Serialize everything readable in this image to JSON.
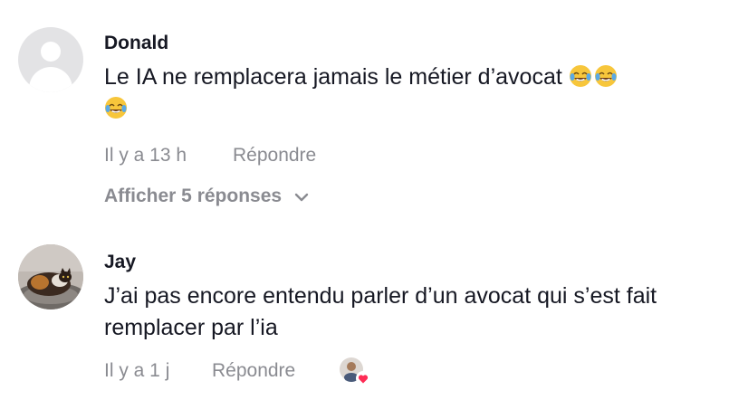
{
  "comments": [
    {
      "username": "Donald",
      "text": "Le IA ne remplacera jamais le métier d’avocat",
      "emojis": [
        "face-with-tears-of-joy",
        "face-with-tears-of-joy",
        "face-with-tears-of-joy"
      ],
      "time": "Il y a 13 h",
      "reply_label": "Répondre",
      "view_replies": "Afficher 5 réponses",
      "avatar": "default-avatar-icon"
    },
    {
      "username": "Jay",
      "text": "J’ai pas encore entendu parler d’un avocat qui s’est fait remplacer par l’ia",
      "time": "Il y a 1 j",
      "reply_label": "Répondre",
      "avatar": "cat-photo",
      "liked_by_creator": true
    }
  ],
  "colors": {
    "text": "#161823",
    "secondary": "#8a8b91",
    "heart": "#fe2c55"
  }
}
